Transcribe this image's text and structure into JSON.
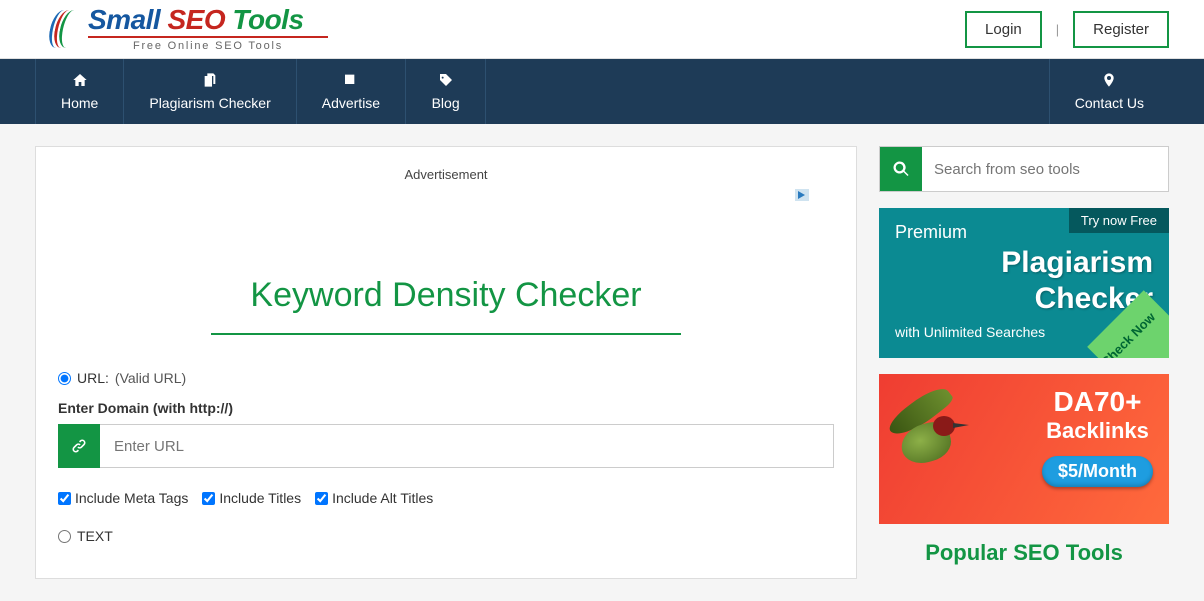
{
  "header": {
    "logo_small": "Small",
    "logo_seo": "SEO",
    "logo_tools": "Tools",
    "logo_sub": "Free Online SEO Tools",
    "login": "Login",
    "register": "Register"
  },
  "nav": {
    "home": "Home",
    "plag": "Plagiarism Checker",
    "advertise": "Advertise",
    "blog": "Blog",
    "contact": "Contact Us"
  },
  "main": {
    "ad_label": "Advertisement",
    "title": "Keyword Density Checker",
    "url_radio": "URL:",
    "url_hint": "(Valid URL)",
    "domain_label": "Enter Domain (with http://)",
    "url_placeholder": "Enter URL",
    "include_meta": "Include Meta Tags",
    "include_titles": "Include Titles",
    "include_alt": "Include Alt Titles",
    "text_radio": "TEXT"
  },
  "sidebar": {
    "search_placeholder": "Search from seo tools",
    "promo1": {
      "premium": "Premium",
      "title1": "Plagiarism",
      "title2": "Checker",
      "sub": "with Unlimited Searches",
      "tab": "Try now Free",
      "corner": "Check Now"
    },
    "promo2": {
      "line1": "DA70+",
      "line2": "Backlinks",
      "price": "$5/Month"
    },
    "popular": "Popular SEO Tools"
  }
}
